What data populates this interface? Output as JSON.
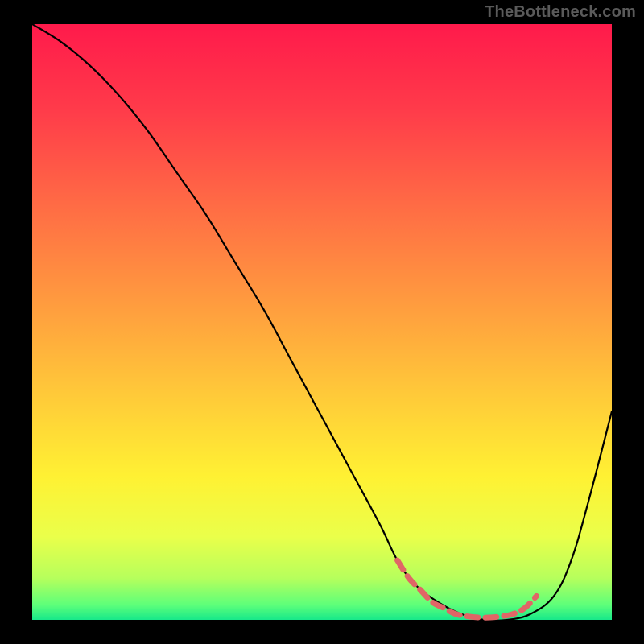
{
  "watermark": "TheBottleneck.com",
  "chart_data": {
    "type": "line",
    "title": "",
    "xlabel": "",
    "ylabel": "",
    "xlim": [
      0,
      100
    ],
    "ylim": [
      0,
      100
    ],
    "grid": false,
    "legend": false,
    "background_gradient_stops": [
      {
        "offset": 0.0,
        "color": "#ff1a4b"
      },
      {
        "offset": 0.14,
        "color": "#ff3a4a"
      },
      {
        "offset": 0.3,
        "color": "#ff6a45"
      },
      {
        "offset": 0.46,
        "color": "#ff993f"
      },
      {
        "offset": 0.62,
        "color": "#ffc939"
      },
      {
        "offset": 0.76,
        "color": "#fff133"
      },
      {
        "offset": 0.86,
        "color": "#eaff4a"
      },
      {
        "offset": 0.93,
        "color": "#b6ff5c"
      },
      {
        "offset": 0.975,
        "color": "#5dff7a"
      },
      {
        "offset": 1.0,
        "color": "#17e88a"
      }
    ],
    "series": [
      {
        "name": "bottleneck-curve",
        "stroke": "#000000",
        "x": [
          0,
          5,
          10,
          15,
          20,
          25,
          30,
          35,
          40,
          45,
          50,
          55,
          60,
          63,
          66,
          70,
          74,
          78,
          82,
          86,
          90,
          93,
          96,
          100
        ],
        "values": [
          100,
          97,
          93,
          88,
          82,
          75,
          68,
          60,
          52,
          43,
          34,
          25,
          16,
          10,
          6,
          3,
          1,
          0,
          0,
          1,
          4,
          10,
          20,
          35
        ]
      }
    ],
    "highlight": {
      "name": "optimal-range",
      "stroke": "#e06666",
      "x": [
        63,
        65,
        67,
        69,
        71,
        73,
        75,
        77,
        79,
        81,
        83,
        85,
        87
      ],
      "values": [
        10,
        7,
        5,
        3,
        2,
        1,
        0.6,
        0.4,
        0.4,
        0.6,
        1,
        2,
        4
      ]
    }
  }
}
